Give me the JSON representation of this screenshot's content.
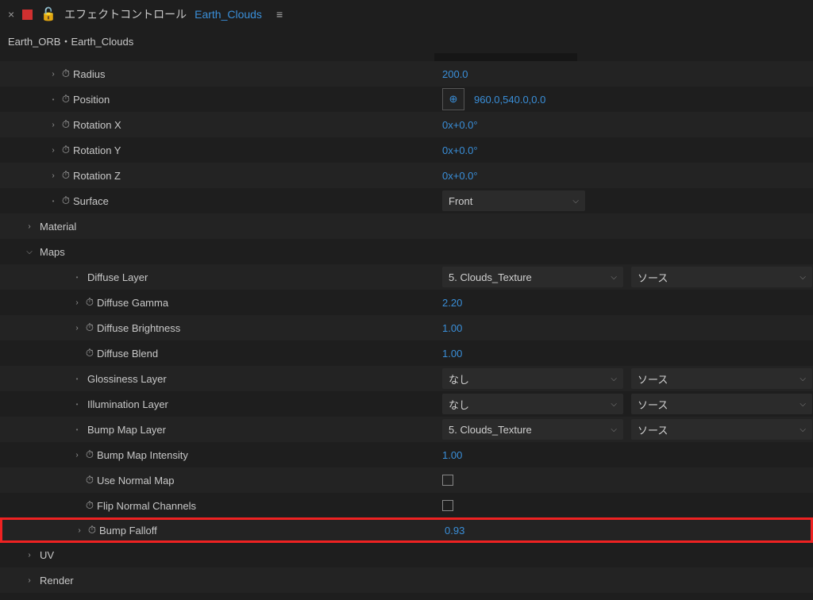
{
  "header": {
    "panel_title": "エフェクトコントロール",
    "panel_title_link": "Earth_Clouds"
  },
  "breadcrumb": "Earth_ORB・Earth_Clouds",
  "props": {
    "radius": {
      "label": "Radius",
      "value": "200.0"
    },
    "position": {
      "label": "Position",
      "value": "960.0,540.0,0.0"
    },
    "rotationX": {
      "label": "Rotation X",
      "value": "0x+0.0°"
    },
    "rotationY": {
      "label": "Rotation Y",
      "value": "0x+0.0°"
    },
    "rotationZ": {
      "label": "Rotation Z",
      "value": "0x+0.0°"
    },
    "surface": {
      "label": "Surface",
      "value": "Front"
    },
    "material": {
      "label": "Material"
    },
    "maps": {
      "label": "Maps"
    },
    "diffuseLayer": {
      "label": "Diffuse Layer",
      "layer": "5. Clouds_Texture",
      "source": "ソース"
    },
    "diffuseGamma": {
      "label": "Diffuse Gamma",
      "value": "2.20"
    },
    "diffuseBrightness": {
      "label": "Diffuse Brightness",
      "value": "1.00"
    },
    "diffuseBlend": {
      "label": "Diffuse Blend",
      "value": "1.00"
    },
    "glossinessLayer": {
      "label": "Glossiness Layer",
      "layer": "なし",
      "source": "ソース"
    },
    "illuminationLayer": {
      "label": "Illumination Layer",
      "layer": "なし",
      "source": "ソース"
    },
    "bumpMapLayer": {
      "label": "Bump Map Layer",
      "layer": "5. Clouds_Texture",
      "source": "ソース"
    },
    "bumpMapIntensity": {
      "label": "Bump Map Intensity",
      "value": "1.00"
    },
    "useNormalMap": {
      "label": "Use Normal Map"
    },
    "flipNormalChannels": {
      "label": "Flip Normal Channels"
    },
    "bumpFalloff": {
      "label": "Bump Falloff",
      "value": "0.93"
    },
    "uv": {
      "label": "UV"
    },
    "render": {
      "label": "Render"
    }
  }
}
